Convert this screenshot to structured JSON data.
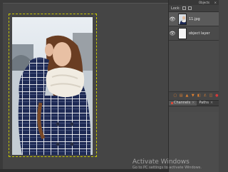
{
  "dock": {
    "title": "Objects",
    "close": "×",
    "mode_label": "Lock:",
    "layers": [
      {
        "name": "11.jpg",
        "visible_glyph": "👁",
        "kind": "photo",
        "active": true
      },
      {
        "name": "object layer",
        "visible_glyph": "👁",
        "kind": "white",
        "active": false
      }
    ],
    "toolbar_icons": [
      "new-layer-icon",
      "group-icon",
      "up-icon",
      "down-icon",
      "duplicate-icon",
      "anchor-icon",
      "mask-icon",
      "delete-icon"
    ],
    "tabs": [
      {
        "label": "Channels",
        "close": "×"
      },
      {
        "label": "Paths",
        "close": "×"
      }
    ]
  },
  "watermark": {
    "line1": "Activate Windows",
    "line2": "Go to PC settings to activate Windows."
  },
  "colors": {
    "canvas_bg": "#454545",
    "dock_bg": "#4a4a4a",
    "selection_border": "#c8c800",
    "accent_orange": "#e08030",
    "accent_red": "#d63a3a"
  }
}
